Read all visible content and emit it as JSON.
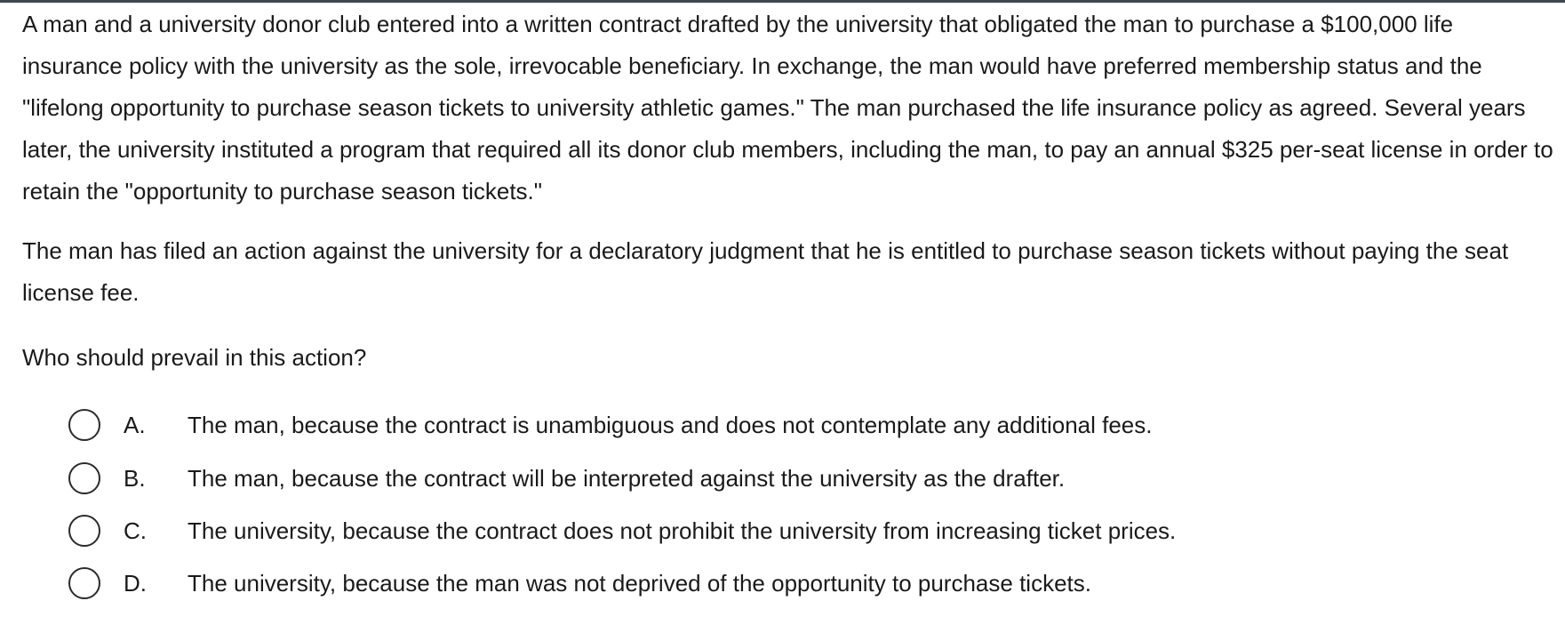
{
  "question": {
    "stem_paragraph_1": "A man and a university donor club entered into a written contract drafted by the university that obligated the man to purchase a $100,000 life insurance policy with the university as the sole, irrevocable beneficiary.  In exchange, the man would have preferred membership status and the \"lifelong opportunity to purchase season tickets to university athletic games.\"  The man purchased the life insurance policy as agreed.  Several years later, the university instituted a program that required all its donor club members, including the man, to pay an annual $325 per-seat license in order to retain the \"opportunity to purchase season tickets.\"",
    "stem_paragraph_2": "The man has filed an action against the university for a declaratory judgment that he is entitled to purchase season tickets without paying the seat license fee.",
    "prompt": "Who should prevail in this action?"
  },
  "options": [
    {
      "letter": "A.",
      "text": "The man, because the contract is unambiguous and does not contemplate any additional fees.",
      "selected": false
    },
    {
      "letter": "B.",
      "text": "The man, because the contract will be interpreted against the university as the drafter.",
      "selected": false
    },
    {
      "letter": "C.",
      "text": "The university, because the contract does not prohibit the university from increasing ticket prices.",
      "selected": false
    },
    {
      "letter": "D.",
      "text": "The university, because the man was not deprived of the opportunity to purchase tickets.",
      "selected": false
    }
  ]
}
